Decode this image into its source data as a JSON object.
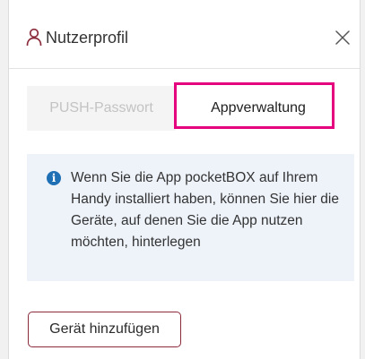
{
  "header": {
    "title": "Nutzerprofil",
    "icon": "user-icon",
    "close_icon": "close-icon"
  },
  "tabs": [
    {
      "label": "PUSH-Passwort",
      "active": false
    },
    {
      "label": "Appverwaltung",
      "active": true
    }
  ],
  "info": {
    "icon": "info-icon",
    "icon_glyph": "i",
    "text": "Wenn Sie die App pocketBOX auf Ihrem Handy installiert haben, können Sie hier die Geräte, auf denen Sie die App nutzen möchten, hinterlegen"
  },
  "actions": {
    "add_device_label": "Gerät hinzufügen"
  },
  "colors": {
    "highlight": "#e5007d",
    "button_border": "#8a2a3a",
    "info_background": "#eef3fa",
    "info_icon": "#1f6fb5"
  }
}
